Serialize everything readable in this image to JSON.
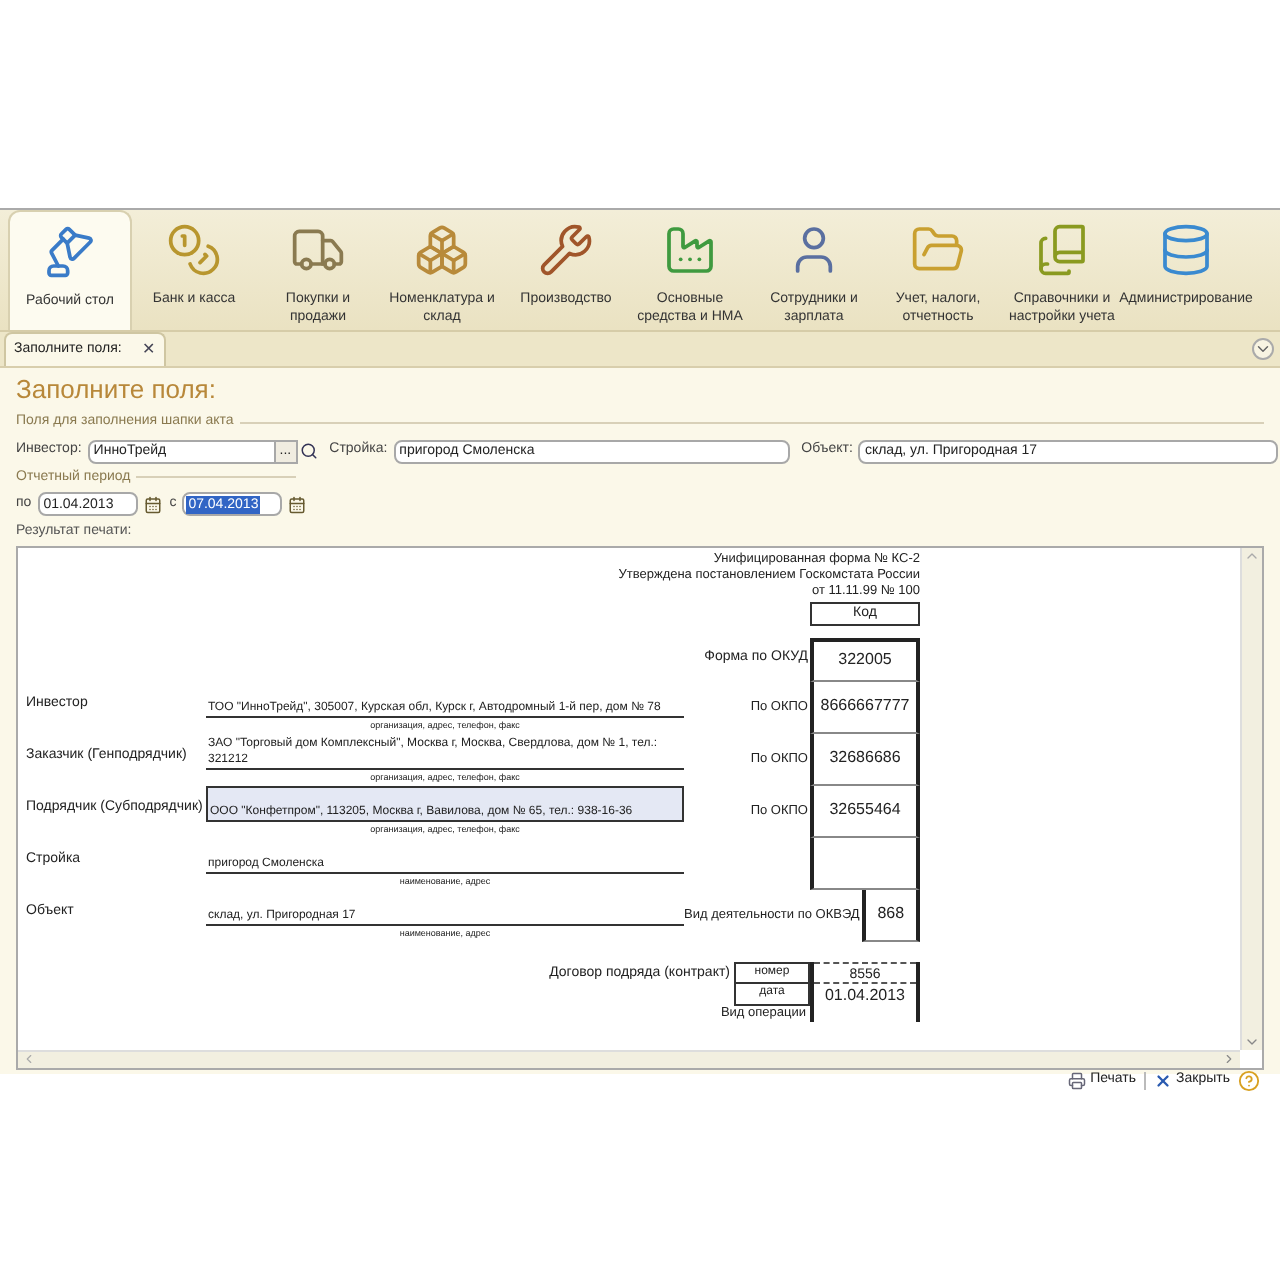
{
  "sections": [
    {
      "label": "Рабочий стол",
      "selected": true
    },
    {
      "label": "Банк и касса",
      "selected": false
    },
    {
      "label": "Покупки и продажи",
      "selected": false
    },
    {
      "label": "Номенклатура и склад",
      "selected": false
    },
    {
      "label": "Производство",
      "selected": false
    },
    {
      "label": "Основные средства и НМА",
      "selected": false
    },
    {
      "label": "Сотрудники и зарплата",
      "selected": false
    },
    {
      "label": "Учет, налоги, отчетность",
      "selected": false
    },
    {
      "label": "Справочники и настройки учета",
      "selected": false
    },
    {
      "label": "Администрирование",
      "selected": false
    }
  ],
  "tab": {
    "label": "Заполните поля:",
    "close": "✕"
  },
  "form": {
    "title": "Заполните поля:",
    "group_header": "Поля для заполнения шапки акта",
    "fields": [
      {
        "label": "Инвестор:",
        "value": "ИнноТрейд",
        "kind": "choice",
        "choose_button": "..."
      },
      {
        "label": "Стройка:",
        "value": "пригород Смоленска",
        "kind": "text"
      },
      {
        "label": "Объект:",
        "value": "склад, ул. Пригородная 17",
        "kind": "text"
      }
    ],
    "period_header": "Отчетный период",
    "period": [
      {
        "label": "по",
        "value": "01.04.2013",
        "highlighted": false
      },
      {
        "label": "с",
        "value": "07.04.2013",
        "highlighted": true
      }
    ],
    "result_label": "Результат печати:"
  },
  "report": {
    "header_lines": [
      "Унифицированная форма № КС-2",
      "Утверждена постановлением  Госкомстата России",
      "от 11.11.99 № 100"
    ],
    "code_heading": "Код",
    "rows": [
      {
        "kind": "code",
        "label": "Форма по ОКУД",
        "code": "322005"
      },
      {
        "kind": "party",
        "label": "Инвестор",
        "value": "ТОО \"ИнноТрейд\", 305007, Курская обл, Курск г, Автодромный 1-й пер, дом № 78",
        "caption": "организация, адрес, телефон, факс",
        "code_label": "По ОКПО",
        "code": "8666667777",
        "selected": false
      },
      {
        "kind": "party",
        "label": "Заказчик (Генподрядчик)",
        "value": "ЗАО \"Торговый дом Комплексный\", Москва г, Москва, Свердлова, дом № 1, тел.: 321212",
        "caption": "организация, адрес, телефон, факс",
        "code_label": "По ОКПО",
        "code": "32686686",
        "selected": false
      },
      {
        "kind": "party",
        "label": "Подрядчик (Субподрядчик)",
        "value": "ООО \"Конфетпром\", 113205, Москва г, Вавилова, дом № 65, тел.: 938-16-36",
        "caption": "организация, адрес, телефон, факс",
        "code_label": "По ОКПО",
        "code": "32655464",
        "selected": true
      },
      {
        "kind": "party",
        "label": "Стройка",
        "value": "пригород Смоленска",
        "caption": "наименование, адрес",
        "selected": false
      },
      {
        "kind": "party",
        "label": "Объект",
        "value": "склад, ул. Пригородная 17",
        "caption": "наименование, адрес",
        "code_label": "Вид деятельности по ОКВЭД",
        "code": "868",
        "selected": false
      },
      {
        "kind": "contract",
        "label": "Договор подряда (контракт)",
        "number_label": "номер",
        "number": "8556",
        "date_label": "дата",
        "date": "01.04.2013"
      },
      {
        "kind": "note",
        "label": "Вид операции"
      }
    ]
  },
  "footer": {
    "print": "Печать",
    "close": "Закрыть"
  }
}
